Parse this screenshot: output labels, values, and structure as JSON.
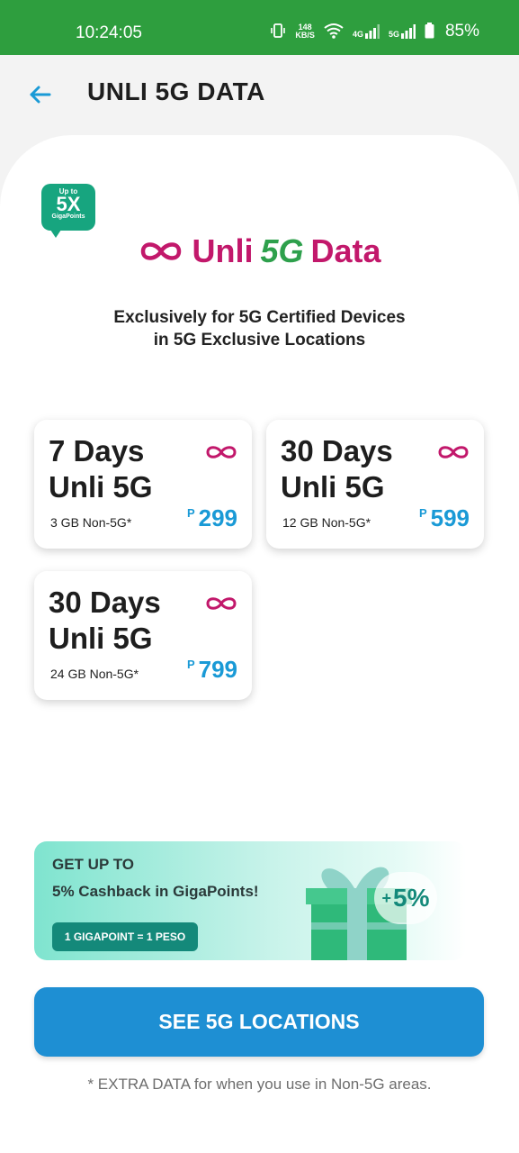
{
  "status_bar": {
    "time": "10:24:05",
    "net_speed_value": "148",
    "net_speed_unit": "KB/S",
    "network_4g": "4G",
    "network_5g": "5G",
    "battery": "85%"
  },
  "header": {
    "title": "UNLI 5G DATA",
    "back_icon": "arrow-left-icon"
  },
  "badge": {
    "line1": "Up to",
    "line2": "5X",
    "line3": "GigaPoints"
  },
  "brand": {
    "word1": "Unli",
    "word2": "5G",
    "word3": "Data",
    "color_primary": "#c2186b",
    "color_5g": "#2ea04c"
  },
  "subtitle": {
    "line1": "Exclusively for 5G Certified Devices",
    "line2": "in 5G Exclusive Locations"
  },
  "plans": [
    {
      "title_line1": "7 Days",
      "title_line2": "Unli 5G",
      "note": "3 GB Non-5G*",
      "currency": "P",
      "price": "299"
    },
    {
      "title_line1": "30 Days",
      "title_line2": "Unli 5G",
      "note": "12 GB Non-5G*",
      "currency": "P",
      "price": "599"
    },
    {
      "title_line1": "30 Days",
      "title_line2": "Unli 5G",
      "note": "24 GB Non-5G*",
      "currency": "P",
      "price": "799"
    }
  ],
  "promo": {
    "line1": "GET UP TO",
    "line2": "5% Cashback in GigaPoints!",
    "pill": "1 GIGAPOINT = 1 PESO",
    "percent_prefix": "+",
    "percent": "5%"
  },
  "cta": {
    "label": "SEE 5G LOCATIONS"
  },
  "footnote": "* EXTRA DATA for when you use in Non-5G areas.",
  "colors": {
    "status_bar": "#2e9e3e",
    "accent_blue": "#1e8fd3",
    "price_blue": "#1a9ad6",
    "teal": "#14897a"
  }
}
